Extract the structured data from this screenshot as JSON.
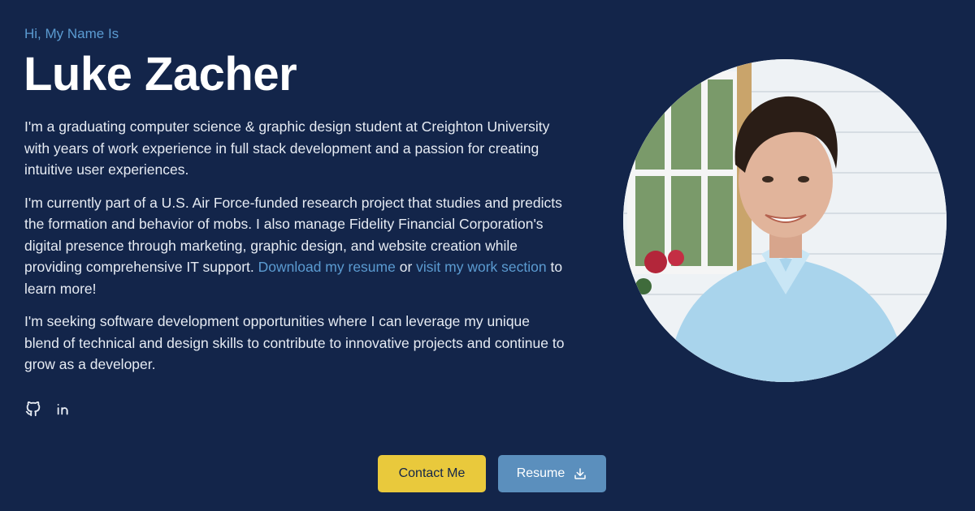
{
  "hero": {
    "intro": "Hi, My Name Is",
    "name": "Luke Zacher"
  },
  "bio": {
    "p1": "I'm a graduating computer science & graphic design student at Creighton University with years of work experience in full stack development and a passion for creating intuitive user experiences.",
    "p2_text": "I'm currently part of a U.S. Air Force-funded research project that studies and predicts the formation and behavior of mobs. I also manage Fidelity Financial Corporation's digital presence through marketing, graphic design, and website creation while providing comprehensive IT support. ",
    "p2_link1": "Download my resume",
    "p2_between": " or ",
    "p2_link2": "visit my work section",
    "p2_end": " to learn more!",
    "p3": "I'm seeking software development opportunities where I can leverage my unique blend of technical and design skills to contribute to innovative projects and continue to grow as a developer."
  },
  "socials": [
    {
      "icon": "github-icon"
    },
    {
      "icon": "linkedin-icon"
    }
  ],
  "buttons": {
    "contact": "Contact Me",
    "resume": "Resume"
  },
  "colors": {
    "background": "#13254a",
    "accent": "#5b9bd1",
    "contact_button": "#e9c93c",
    "resume_button": "#5b8fbd"
  }
}
